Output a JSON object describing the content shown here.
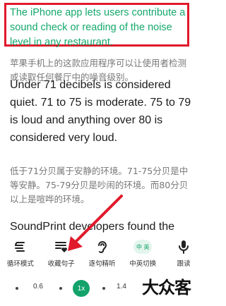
{
  "article": {
    "p1_en": "The iPhone app lets users contribute a sound check or reading of the noise level in any restaurant.",
    "p1_zh": "苹果手机上的这款应用程序可以让使用者检测或读取任何餐厅中的噪音级别。",
    "p2_en": "Under 71 decibels is considered quiet. 71 to 75 is moderate. 75 to 79 is loud and anything over 80 is considered very loud.",
    "p2_zh": "低于71分贝属于安静的环境。71-75分贝是中等安静。75-79分贝是吵闹的环境。而80分贝以上是喧哗的环境。",
    "p3_en": "SoundPrint developers found the"
  },
  "toolbar": {
    "items": [
      {
        "label": "循环模式",
        "icon": "loop-list-icon"
      },
      {
        "label": "收藏句子",
        "icon": "favorite-list-icon"
      },
      {
        "label": "逐句精听",
        "icon": "ear-icon"
      },
      {
        "label": "中英切换",
        "icon": "language-toggle-icon",
        "badge": "中 英"
      },
      {
        "label": "跟读",
        "icon": "microphone-icon"
      }
    ]
  },
  "speed": {
    "values": [
      "0.6",
      "1x",
      "1.4"
    ],
    "current": "1x"
  },
  "watermark": "大众客",
  "colors": {
    "accent": "#12a26a",
    "highlight": "#e0192b",
    "arrow": "#e0192b"
  }
}
